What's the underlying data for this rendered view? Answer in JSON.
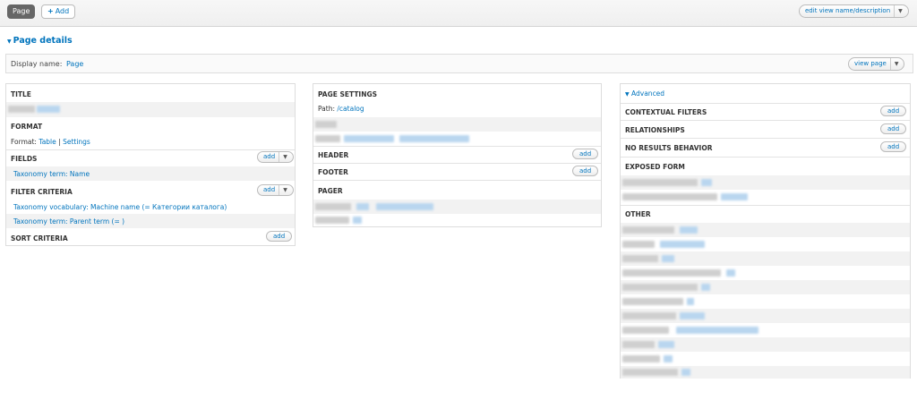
{
  "topbar": {
    "page_tab": "Page",
    "add_tab": "Add",
    "edit_view": "edit view name/description"
  },
  "page_details": {
    "title": "Page details",
    "display_name_label": "Display name:",
    "display_name_value": "Page",
    "view_page_label": "view page"
  },
  "left": {
    "title_header": "TITLE",
    "format_header": "FORMAT",
    "format_label": "Format:",
    "format_value": "Table",
    "format_sep": "|",
    "format_settings": "Settings",
    "fields_header": "FIELDS",
    "fields_items": [
      "Taxonomy term: Name"
    ],
    "filter_header": "FILTER CRITERIA",
    "filter_items": [
      "Taxonomy vocabulary: Machine name (= Категории каталога)",
      "Taxonomy term: Parent term (= )"
    ],
    "sort_header": "SORT CRITERIA",
    "add_label": "add"
  },
  "middle": {
    "settings_header": "PAGE SETTINGS",
    "path_label": "Path:",
    "path_value": "/catalog",
    "header_header": "HEADER",
    "footer_header": "FOOTER",
    "pager_header": "PAGER",
    "add_label": "add"
  },
  "right": {
    "advanced_label": "Advanced",
    "contextual_header": "CONTEXTUAL FILTERS",
    "relationships_header": "RELATIONSHIPS",
    "noresults_header": "NO RESULTS BEHAVIOR",
    "exposed_header": "EXPOSED FORM",
    "other_header": "OTHER",
    "add_label": "add"
  },
  "icons": {
    "add": "plus-icon",
    "dropdown": "caret-down-icon",
    "collapse": "triangle-down-icon"
  },
  "colors": {
    "link": "#0074bd",
    "tab_active": "#666666"
  }
}
